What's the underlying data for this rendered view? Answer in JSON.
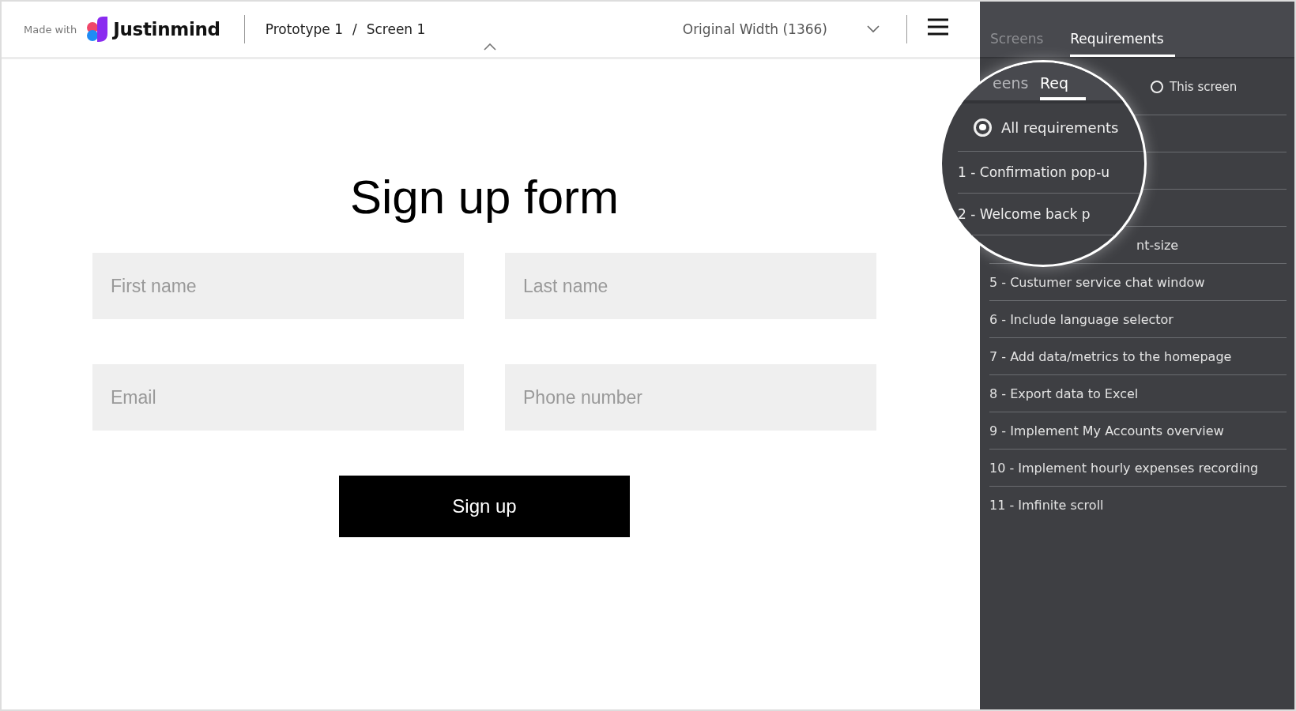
{
  "header": {
    "made_with": "Made with",
    "brand": "Justinmind",
    "breadcrumb": [
      "Prototype 1",
      "Screen 1"
    ],
    "separator": "/",
    "width_selector": "Original Width (1366)"
  },
  "form": {
    "title": "Sign up form",
    "fields": [
      {
        "placeholder": "First name"
      },
      {
        "placeholder": "Last name"
      },
      {
        "placeholder": "Email"
      },
      {
        "placeholder": "Phone number"
      }
    ],
    "submit": "Sign up"
  },
  "panel": {
    "tabs": [
      {
        "label": "Screens",
        "selected": false
      },
      {
        "label": "Requirements",
        "selected": true
      }
    ],
    "filter": {
      "label": "This screen",
      "selected": false
    },
    "requirements": [
      {
        "label": "nt-size",
        "partial": true
      },
      {
        "label": "5 - Custumer service chat window",
        "partial": false
      },
      {
        "label": "6 - Include language selector",
        "partial": false
      },
      {
        "label": "7 - Add data/metrics to the homepage",
        "partial": false
      },
      {
        "label": "8 - Export data to Excel",
        "partial": false
      },
      {
        "label": "9 - Implement My Accounts overview",
        "partial": false
      },
      {
        "label": "10 - Implement hourly expenses recording",
        "partial": false
      },
      {
        "label": "11 - Imfinite scroll",
        "partial": false
      }
    ]
  },
  "magnifier": {
    "tabs": [
      {
        "label": "eens",
        "selected": false
      },
      {
        "label": "Req",
        "selected": true
      }
    ],
    "filter": {
      "label": "All requirements",
      "selected": true
    },
    "requirements": [
      "1 - Confirmation pop-u",
      "2 - Welcome back p"
    ]
  }
}
